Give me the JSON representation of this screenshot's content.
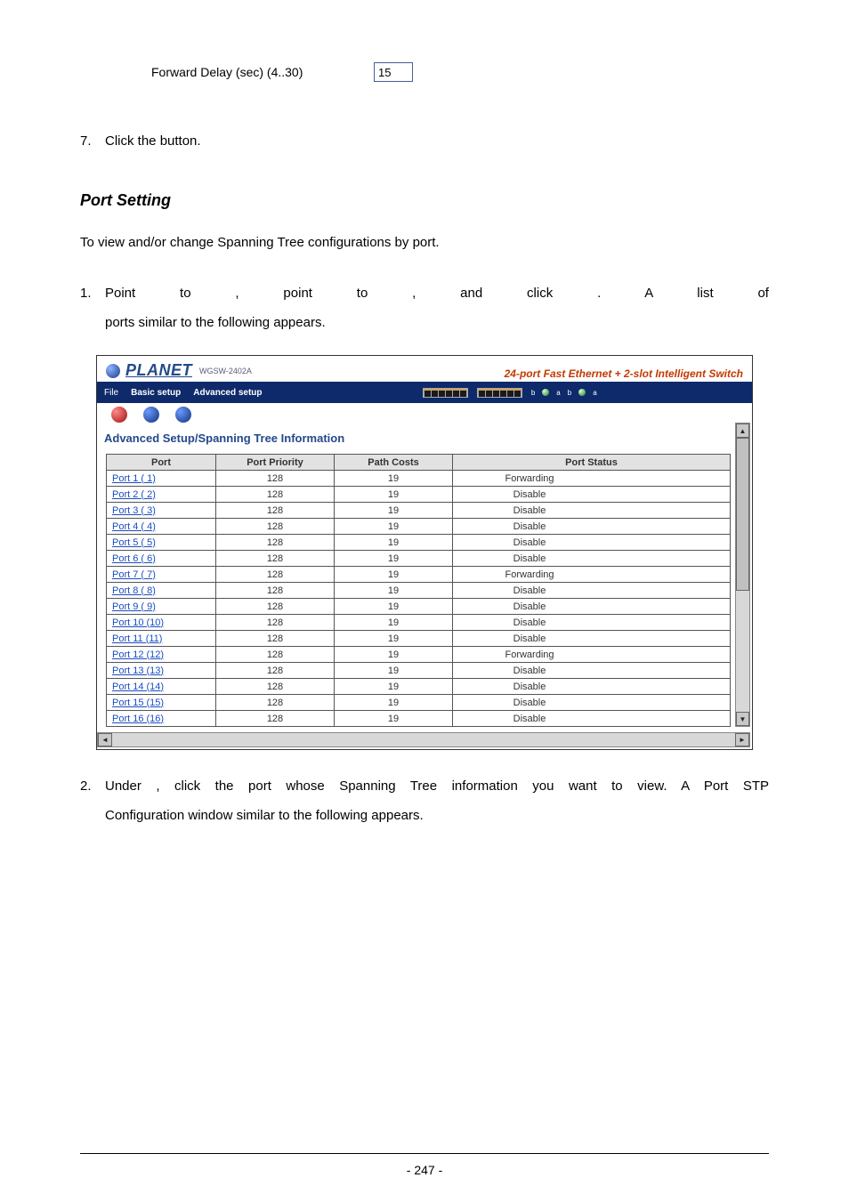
{
  "forwardDelay": {
    "label": "Forward Delay (sec) (4..30)",
    "value": "15"
  },
  "step7_pre": "Click the ",
  "step7_post": " button.",
  "sectionTitle": "Port Setting",
  "intro": "To view and/or change Spanning Tree configurations by port.",
  "step1_a": "Point to ",
  "step1_b": ", point to ",
  "step1_c": ", and click ",
  "step1_d": ". A list of",
  "step1_e": "ports similar to the following appears.",
  "banner": {
    "brand": "PLANET",
    "model": "WGSW-2402A",
    "tagline": "24-port Fast Ethernet + 2-slot Intelligent Switch"
  },
  "tabs": {
    "file": "File",
    "basic": "Basic setup",
    "advanced": "Advanced setup"
  },
  "tableTitle": "Advanced Setup/Spanning Tree Information",
  "columns": {
    "port": "Port",
    "priority": "Port Priority",
    "path": "Path Costs",
    "status": "Port Status"
  },
  "rows": [
    {
      "port": "Port 1 ( 1)",
      "priority": "128",
      "path": "19",
      "status": "Forwarding"
    },
    {
      "port": "Port 2 ( 2)",
      "priority": "128",
      "path": "19",
      "status": "Disable"
    },
    {
      "port": "Port 3 ( 3)",
      "priority": "128",
      "path": "19",
      "status": "Disable"
    },
    {
      "port": "Port 4 ( 4)",
      "priority": "128",
      "path": "19",
      "status": "Disable"
    },
    {
      "port": "Port 5 ( 5)",
      "priority": "128",
      "path": "19",
      "status": "Disable"
    },
    {
      "port": "Port 6 ( 6)",
      "priority": "128",
      "path": "19",
      "status": "Disable"
    },
    {
      "port": "Port 7 ( 7)",
      "priority": "128",
      "path": "19",
      "status": "Forwarding"
    },
    {
      "port": "Port 8 ( 8)",
      "priority": "128",
      "path": "19",
      "status": "Disable"
    },
    {
      "port": "Port 9 ( 9)",
      "priority": "128",
      "path": "19",
      "status": "Disable"
    },
    {
      "port": "Port 10 (10)",
      "priority": "128",
      "path": "19",
      "status": "Disable"
    },
    {
      "port": "Port 11 (11)",
      "priority": "128",
      "path": "19",
      "status": "Disable"
    },
    {
      "port": "Port 12 (12)",
      "priority": "128",
      "path": "19",
      "status": "Forwarding"
    },
    {
      "port": "Port 13 (13)",
      "priority": "128",
      "path": "19",
      "status": "Disable"
    },
    {
      "port": "Port 14 (14)",
      "priority": "128",
      "path": "19",
      "status": "Disable"
    },
    {
      "port": "Port 15 (15)",
      "priority": "128",
      "path": "19",
      "status": "Disable"
    },
    {
      "port": "Port 16 (16)",
      "priority": "128",
      "path": "19",
      "status": "Disable"
    }
  ],
  "step2_a": "Under ",
  "step2_b": ", click the port whose Spanning Tree information you want to view. A Port STP",
  "step2_c": "Configuration window similar to the following appears.",
  "pageNumber": "- 247 -"
}
